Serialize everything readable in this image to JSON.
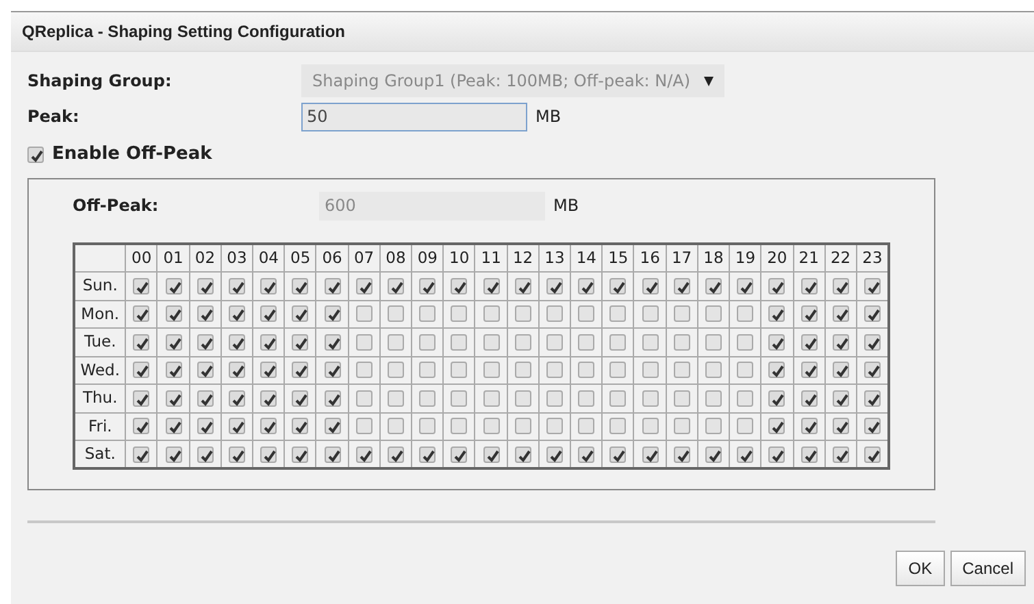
{
  "window": {
    "title": "QReplica - Shaping Setting Configuration"
  },
  "shaping_group": {
    "label": "Shaping Group:",
    "value": "Shaping Group1 (Peak: 100MB; Off-peak: N/A)",
    "disabled": true
  },
  "peak": {
    "label": "Peak:",
    "value": "50",
    "unit": "MB"
  },
  "enable_off_peak": {
    "label": "Enable Off-Peak",
    "checked": true
  },
  "off_peak": {
    "label": "Off-Peak:",
    "value": "600",
    "unit": "MB",
    "disabled": true
  },
  "schedule": {
    "hours": [
      "00",
      "01",
      "02",
      "03",
      "04",
      "05",
      "06",
      "07",
      "08",
      "09",
      "10",
      "11",
      "12",
      "13",
      "14",
      "15",
      "16",
      "17",
      "18",
      "19",
      "20",
      "21",
      "22",
      "23"
    ],
    "rows": [
      {
        "day": "Sun.",
        "checked": [
          true,
          true,
          true,
          true,
          true,
          true,
          true,
          true,
          true,
          true,
          true,
          true,
          true,
          true,
          true,
          true,
          true,
          true,
          true,
          true,
          true,
          true,
          true,
          true
        ]
      },
      {
        "day": "Mon.",
        "checked": [
          true,
          true,
          true,
          true,
          true,
          true,
          true,
          false,
          false,
          false,
          false,
          false,
          false,
          false,
          false,
          false,
          false,
          false,
          false,
          false,
          true,
          true,
          true,
          true
        ]
      },
      {
        "day": "Tue.",
        "checked": [
          true,
          true,
          true,
          true,
          true,
          true,
          true,
          false,
          false,
          false,
          false,
          false,
          false,
          false,
          false,
          false,
          false,
          false,
          false,
          false,
          true,
          true,
          true,
          true
        ]
      },
      {
        "day": "Wed.",
        "checked": [
          true,
          true,
          true,
          true,
          true,
          true,
          true,
          false,
          false,
          false,
          false,
          false,
          false,
          false,
          false,
          false,
          false,
          false,
          false,
          false,
          true,
          true,
          true,
          true
        ]
      },
      {
        "day": "Thu.",
        "checked": [
          true,
          true,
          true,
          true,
          true,
          true,
          true,
          false,
          false,
          false,
          false,
          false,
          false,
          false,
          false,
          false,
          false,
          false,
          false,
          false,
          true,
          true,
          true,
          true
        ]
      },
      {
        "day": "Fri.",
        "checked": [
          true,
          true,
          true,
          true,
          true,
          true,
          true,
          false,
          false,
          false,
          false,
          false,
          false,
          false,
          false,
          false,
          false,
          false,
          false,
          false,
          true,
          true,
          true,
          true
        ]
      },
      {
        "day": "Sat.",
        "checked": [
          true,
          true,
          true,
          true,
          true,
          true,
          true,
          true,
          true,
          true,
          true,
          true,
          true,
          true,
          true,
          true,
          true,
          true,
          true,
          true,
          true,
          true,
          true,
          true
        ]
      }
    ]
  },
  "buttons": [
    "OK",
    "Cancel"
  ]
}
